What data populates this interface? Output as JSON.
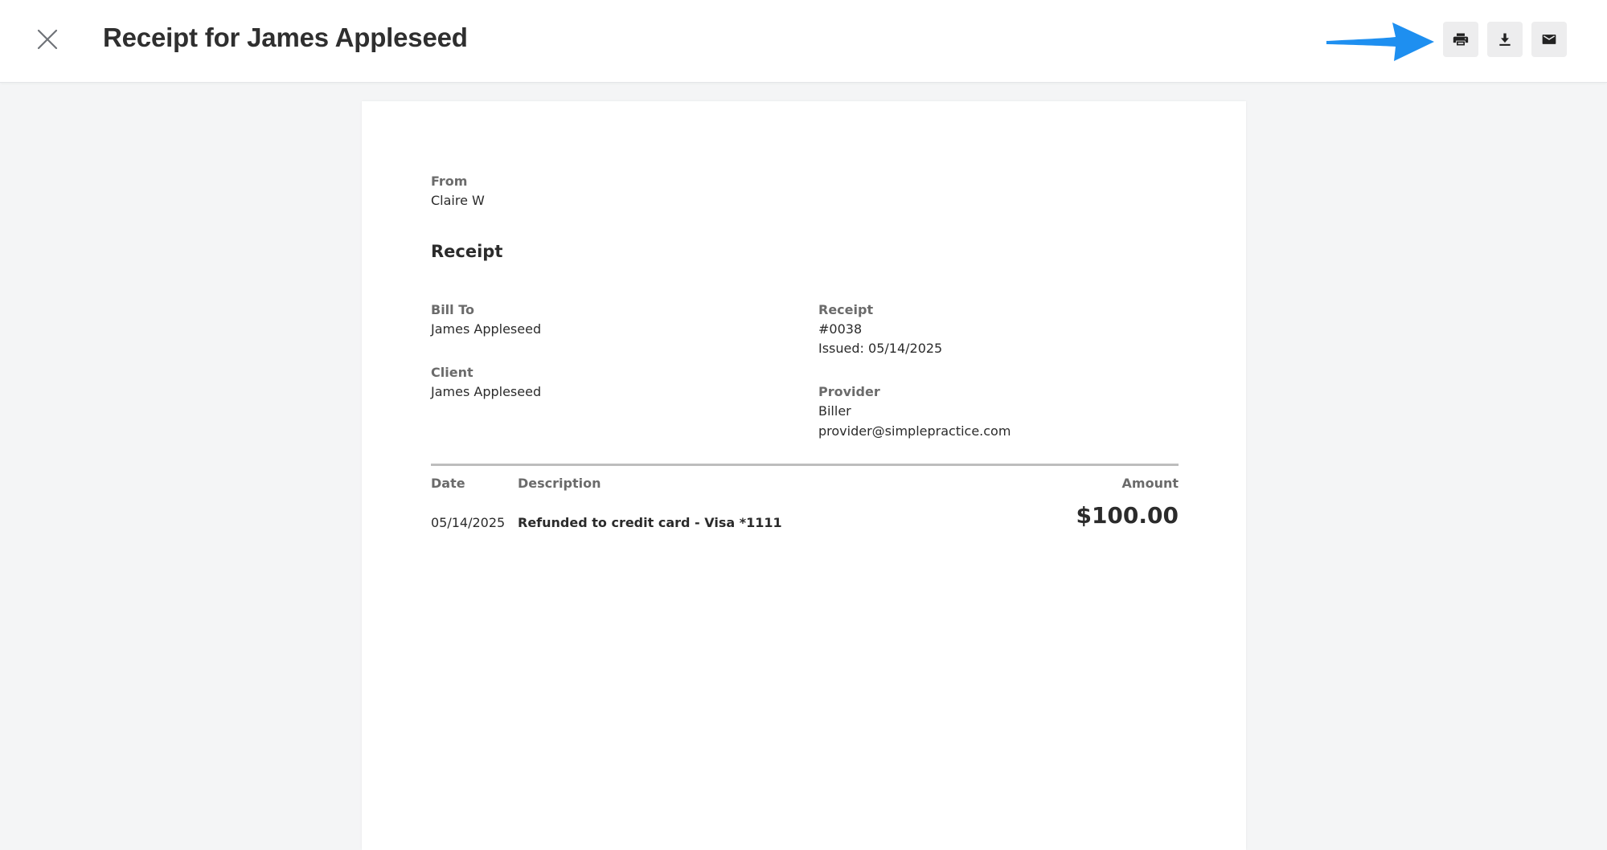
{
  "header": {
    "title": "Receipt for James Appleseed",
    "actions": {
      "print": "print-icon",
      "download": "download-icon",
      "email": "email-icon"
    },
    "arrow_color": "#1e8ff0"
  },
  "receipt": {
    "from_label": "From",
    "from_value": "Claire W",
    "heading": "Receipt",
    "bill_to_label": "Bill To",
    "bill_to_value": "James Appleseed",
    "client_label": "Client",
    "client_value": "James Appleseed",
    "receipt_label": "Receipt",
    "receipt_number": "#0038",
    "issued": "Issued: 05/14/2025",
    "provider_label": "Provider",
    "provider_name": "Biller",
    "provider_email": "provider@simplepractice.com",
    "table": {
      "headers": {
        "date": "Date",
        "description": "Description",
        "amount": "Amount"
      },
      "rows": [
        {
          "date": "05/14/2025",
          "description": "Refunded to credit card - Visa *1111",
          "amount": "$100.00"
        }
      ]
    }
  }
}
